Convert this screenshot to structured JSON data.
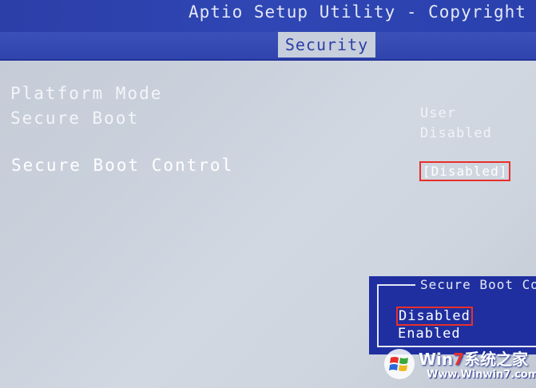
{
  "header": {
    "title": "Aptio Setup Utility - Copyright (C)",
    "active_tab": "Security"
  },
  "settings": [
    {
      "label": "Platform Mode",
      "value": "User"
    },
    {
      "label": "Secure Boot",
      "value": "Disabled"
    },
    {
      "label": "Secure Boot Control",
      "value": "[Disabled]"
    }
  ],
  "popup": {
    "title": "Secure Boot Co",
    "options": [
      "Disabled",
      "Enabled"
    ],
    "selected": "Disabled"
  },
  "watermark": {
    "brand_prefix": "Win",
    "brand_seven": "7",
    "brand_suffix": "系统之家",
    "url": "Www.Winwin7.com"
  },
  "colors": {
    "bios_blue": "#2f45ad",
    "highlight_red": "#e8302a",
    "text_white": "#ffffff"
  }
}
